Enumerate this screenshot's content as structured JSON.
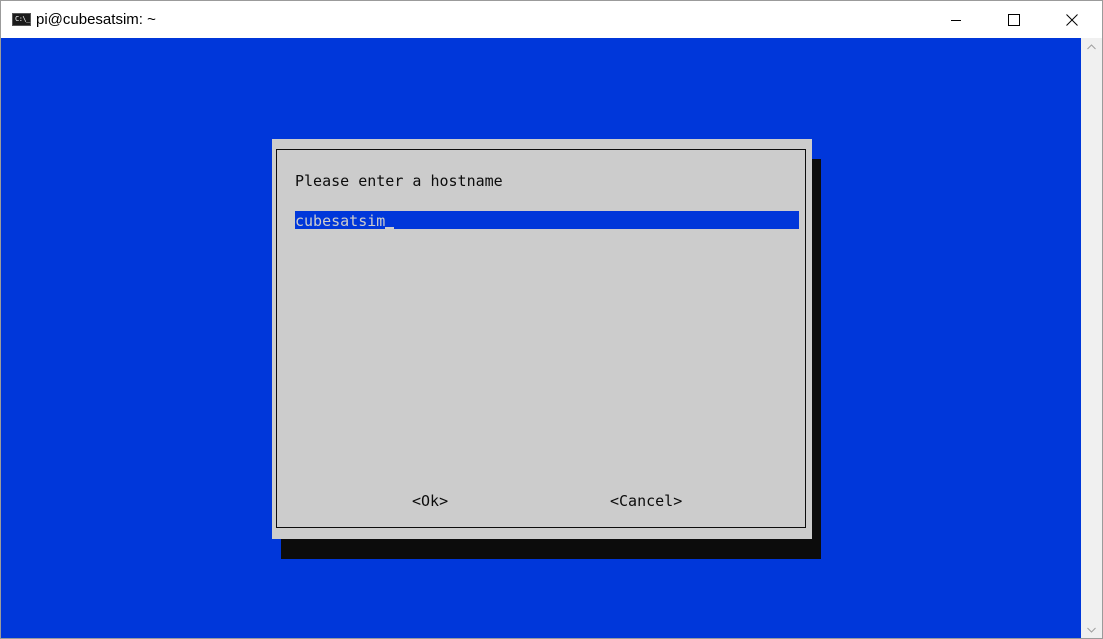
{
  "window": {
    "title": "pi@cubesatsim: ~",
    "icon_text": "C:\\_"
  },
  "dialog": {
    "prompt": "Please enter a hostname",
    "hostname_value": "cubesatsim",
    "ok_label": "<Ok>",
    "cancel_label": "<Cancel>"
  },
  "colors": {
    "terminal_background": "#0037da",
    "dialog_background": "#cccccc",
    "shadow": "#0c0c0c",
    "input_background": "#0037da",
    "input_text": "#cccccc"
  },
  "icons": {
    "minimize": "minimize-icon",
    "maximize": "maximize-icon",
    "close": "close-icon",
    "app": "terminal-app-icon"
  }
}
